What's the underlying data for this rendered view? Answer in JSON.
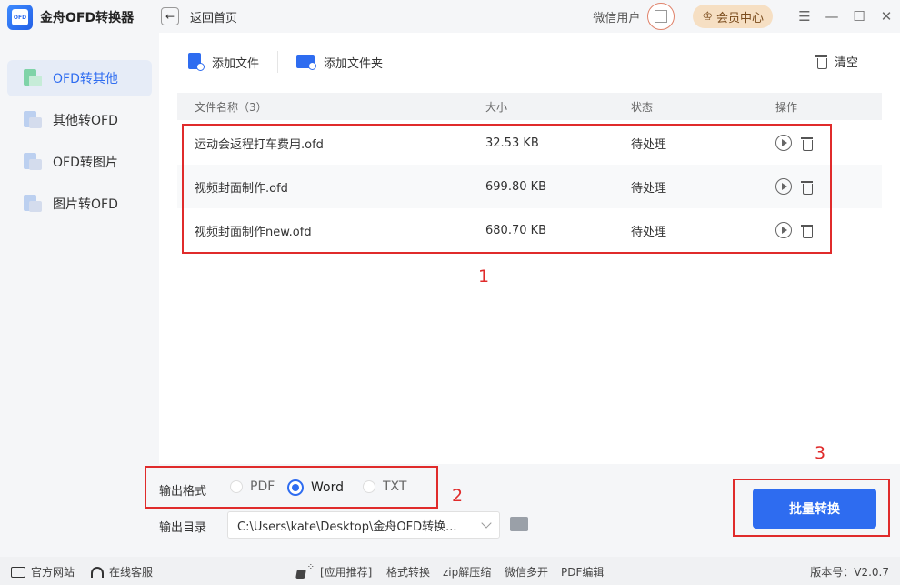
{
  "app": {
    "name": "金舟OFD转换器",
    "logo_text": "OFD"
  },
  "sidebar": {
    "items": [
      {
        "label": "OFD转其他",
        "active": true
      },
      {
        "label": "其他转OFD",
        "active": false
      },
      {
        "label": "OFD转图片",
        "active": false
      },
      {
        "label": "图片转OFD",
        "active": false
      }
    ]
  },
  "topbar": {
    "back_label": "返回首页",
    "user_name": "微信用户",
    "vip_label": "会员中心"
  },
  "toolbar": {
    "add_file": "添加文件",
    "add_folder": "添加文件夹",
    "clear": "清空"
  },
  "table": {
    "headers": [
      "文件名称（3）",
      "大小",
      "状态",
      "操作"
    ],
    "rows": [
      {
        "name": "运动会返程打车费用.ofd",
        "size": "32.53 KB",
        "status": "待处理"
      },
      {
        "name": "视频封面制作.ofd",
        "size": "699.80 KB",
        "status": "待处理"
      },
      {
        "name": "视频封面制作new.ofd",
        "size": "680.70 KB",
        "status": "待处理"
      }
    ]
  },
  "output": {
    "format_label": "输出格式",
    "formats": [
      "PDF",
      "Word",
      "TXT"
    ],
    "selected_format": "Word",
    "dir_label": "输出目录",
    "dir_value": "C:\\Users\\kate\\Desktop\\金舟OFD转换..."
  },
  "convert_button": "批量转换",
  "annotations": [
    "1",
    "2",
    "3"
  ],
  "footer": {
    "website": "官方网站",
    "support": "在线客服",
    "recommend": "[应用推荐]",
    "links": [
      "格式转换",
      "zip解压缩",
      "微信多开",
      "PDF编辑"
    ],
    "version": "版本号：V2.0.7"
  },
  "colors": {
    "accent": "#2e6cf0",
    "annotation": "#e02b2b",
    "vip_bg": "#f6dfc3"
  }
}
